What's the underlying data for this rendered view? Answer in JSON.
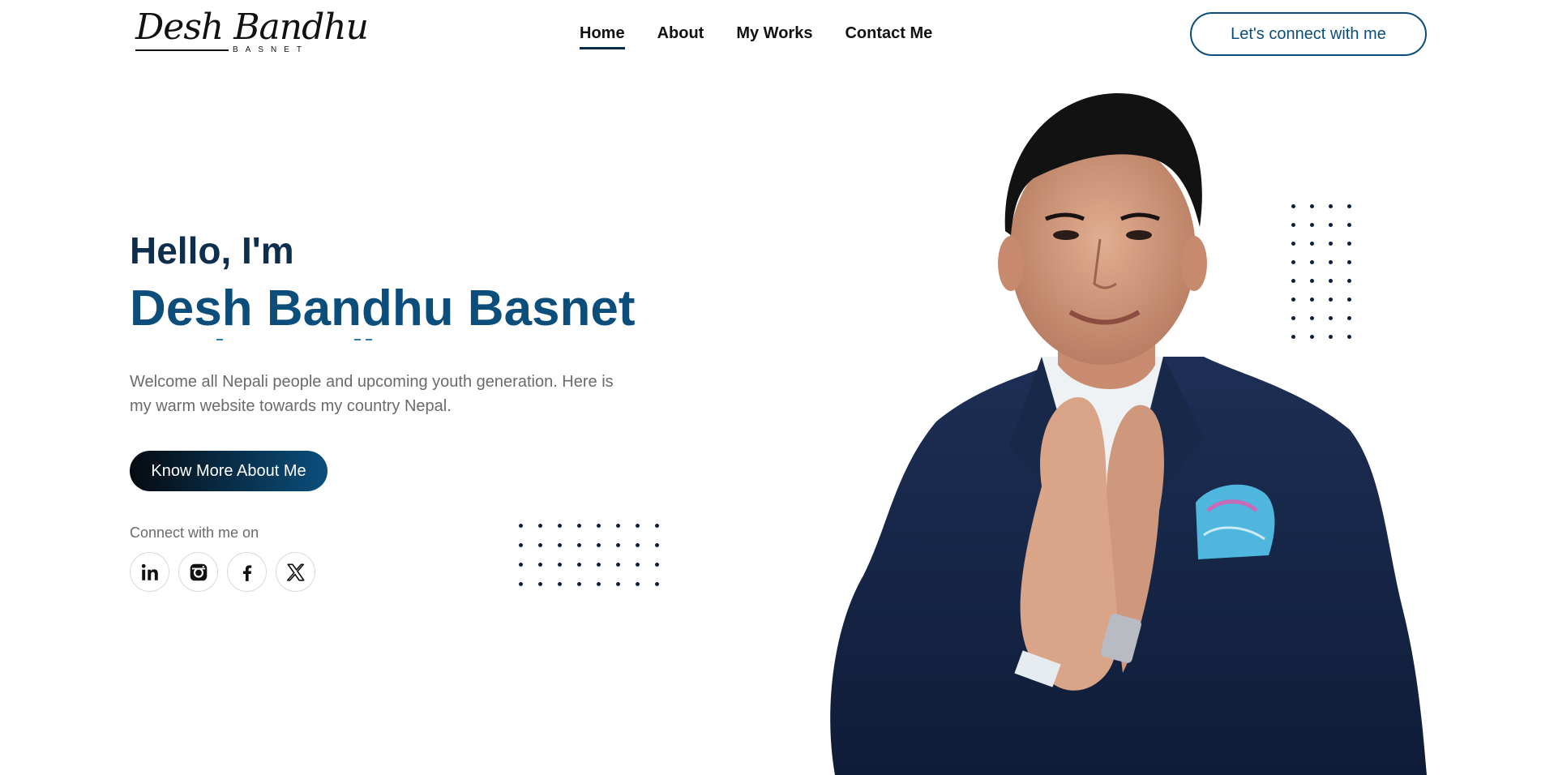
{
  "logo": {
    "script": "Desh Bandhu",
    "sub": "BASNET"
  },
  "nav": {
    "items": [
      "Home",
      "About",
      "My Works",
      "Contact Me"
    ],
    "active": "Home"
  },
  "header": {
    "connect_label": "Let's connect with me"
  },
  "hero": {
    "greeting": "Hello, I'm",
    "name": "Desh Bandhu Basnet",
    "description": "Welcome all Nepali people and upcoming youth generation. Here is my warm website towards my country Nepal.",
    "cta_label": "Know More About Me",
    "connect_label": "Connect with me on"
  },
  "socials": [
    {
      "name": "linkedin-icon"
    },
    {
      "name": "instagram-icon"
    },
    {
      "name": "facebook-icon"
    },
    {
      "name": "x-twitter-icon"
    }
  ],
  "colors": {
    "primary": "#0b4e7c",
    "dark": "#0d2e4d",
    "dots": "#0d1e3a"
  }
}
